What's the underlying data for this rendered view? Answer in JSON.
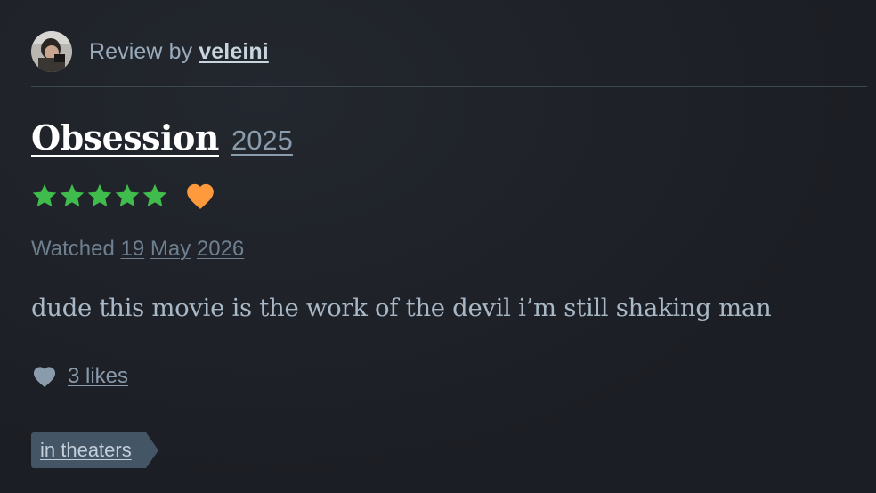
{
  "header": {
    "prefix": "Review by",
    "username": "veleini"
  },
  "film": {
    "title": "Obsession",
    "year": "2025"
  },
  "rating": {
    "stars": 5,
    "max_stars": 5,
    "liked": true,
    "star_color": "#40bc4c",
    "heart_color": "#ff9a3c"
  },
  "watched": {
    "label": "Watched",
    "day": "19",
    "month": "May",
    "year": "2026"
  },
  "review": {
    "text": "dude this movie is the work of the devil i’m still shaking man"
  },
  "likes": {
    "icon": "heart-icon",
    "label": "3 likes"
  },
  "tags": [
    {
      "label": "in theaters"
    }
  ]
}
